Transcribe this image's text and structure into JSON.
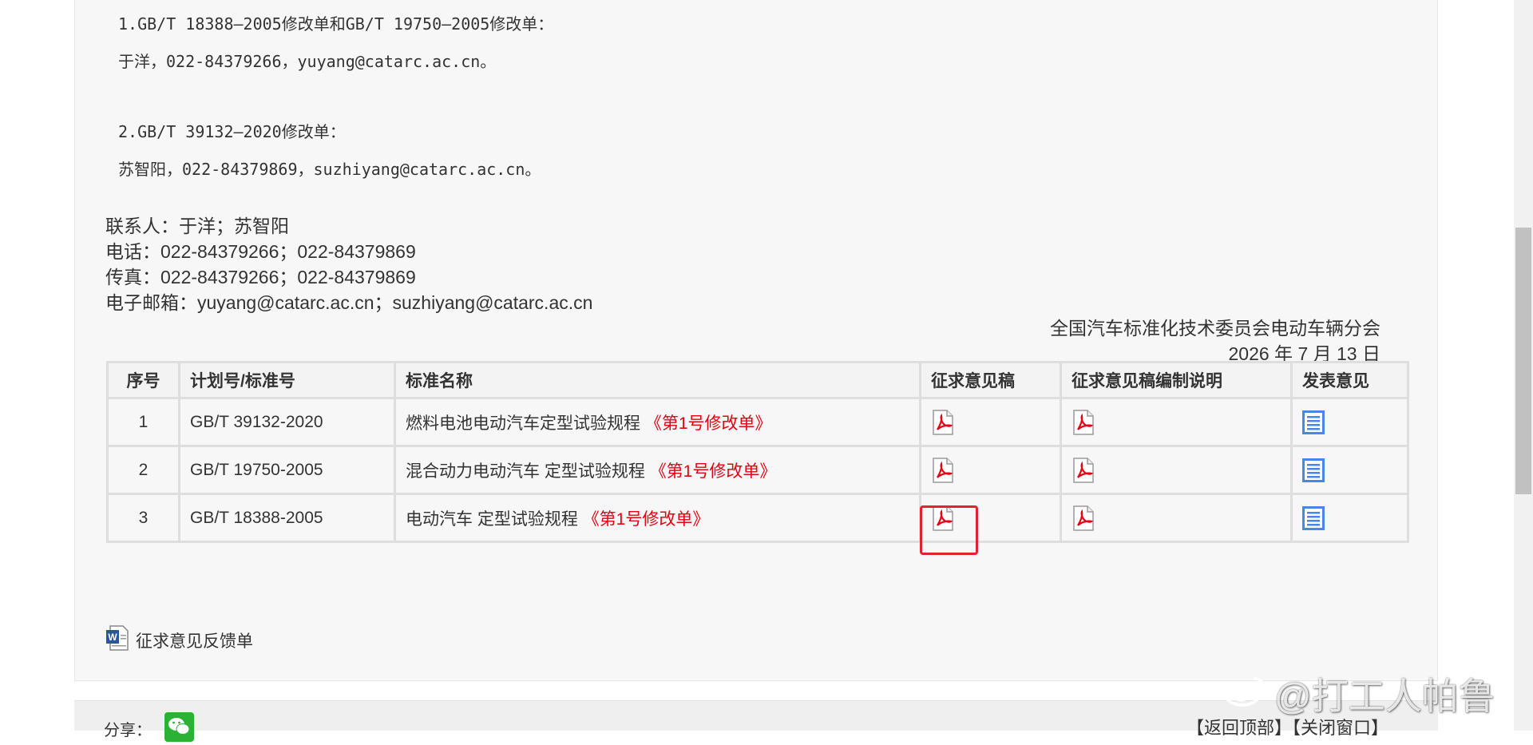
{
  "notice": {
    "item1_title": "1.GB/T 18388—2005修改单和GB/T 19750—2005修改单：",
    "item1_contact": "于洋，022-84379266，yuyang@catarc.ac.cn。",
    "item2_title": "2.GB/T 39132—2020修改单：",
    "item2_contact": "苏智阳，022-84379869，suzhiyang@catarc.ac.cn。",
    "contact_person": "联系人：于洋；苏智阳",
    "phone": "电话：022-84379266；022-84379869",
    "fax": "传真：022-84379266；022-84379869",
    "email": "电子邮箱：yuyang@catarc.ac.cn；suzhiyang@catarc.ac.cn",
    "org": "全国汽车标准化技术委员会电动车辆分会",
    "date": "2026 年 7 月 13 日"
  },
  "table": {
    "headers": [
      "序号",
      "计划号/标准号",
      "标准名称",
      "征求意见稿",
      "征求意见稿编制说明",
      "发表意见"
    ],
    "rows": [
      {
        "no": "1",
        "std": "GB/T 39132-2020",
        "name": "燃料电池电动汽车定型试验规程",
        "amend": "《第1号修改单》"
      },
      {
        "no": "2",
        "std": "GB/T 19750-2005",
        "name": "混合动力电动汽车 定型试验规程",
        "amend": "《第1号修改单》"
      },
      {
        "no": "3",
        "std": "GB/T 18388-2005",
        "name": "电动汽车 定型试验规程",
        "amend": "《第1号修改单》"
      }
    ]
  },
  "feedback_label": "征求意见反馈单",
  "footer": {
    "share_label": "分享：",
    "links": "【返回顶部】【关闭窗口】"
  },
  "watermark": "@打工人帕鲁",
  "colors": {
    "amend_red": "#e60012",
    "highlight_red": "#e0232c",
    "comment_blue": "#4a86e8"
  },
  "icons": {
    "draft": "pdf-icon",
    "explanation": "pdf-icon",
    "comment": "document-list-icon",
    "feedback": "word-doc-icon",
    "share": "wechat-icon"
  }
}
